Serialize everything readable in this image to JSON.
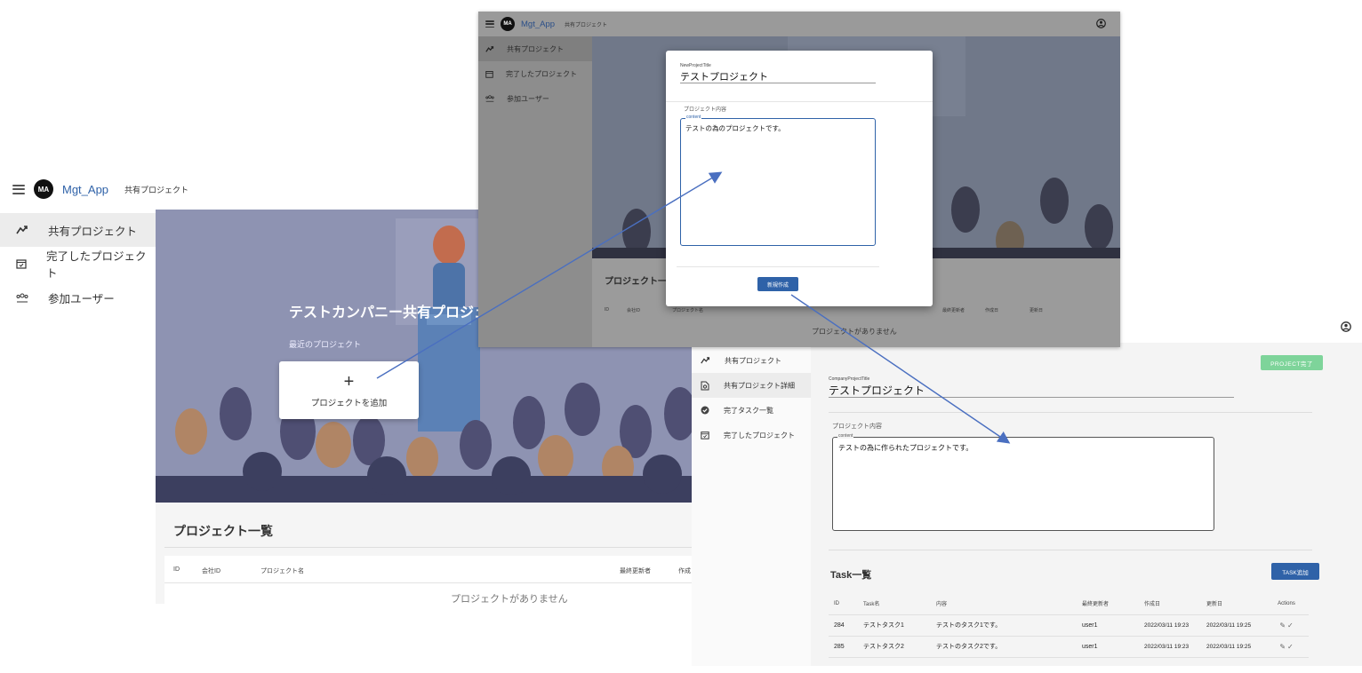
{
  "left": {
    "app_initials": "MA",
    "app_name": "Mgt_App",
    "breadcrumb": "共有プロジェクト",
    "nav": [
      {
        "label": "共有プロジェクト",
        "icon": "share-icon"
      },
      {
        "label": "完了したプロジェクト",
        "icon": "calendar-check-icon"
      },
      {
        "label": "参加ユーザー",
        "icon": "group-icon"
      }
    ],
    "hero_title": "テストカンパニー共有プロジェ",
    "recent_label": "最近のプロジェクト",
    "add_plus": "+",
    "add_label": "プロジェクトを追加",
    "list_title": "プロジェクト一覧",
    "columns": [
      "ID",
      "会社ID",
      "プロジェクト名",
      "最終更新者",
      "作成"
    ],
    "empty_text": "プロジェクトがありません"
  },
  "top": {
    "app_initials": "MA",
    "app_name": "Mgt_App",
    "breadcrumb": "共有プロジェクト",
    "nav": [
      {
        "label": "共有プロジェクト",
        "icon": "share-icon"
      },
      {
        "label": "完了したプロジェクト",
        "icon": "calendar-check-icon"
      },
      {
        "label": "参加ユーザー",
        "icon": "group-icon"
      }
    ],
    "modal": {
      "title_caption": "NewProjectTitle",
      "title_value": "テストプロジェクト",
      "content_section": "プロジェクト内容",
      "content_legend": "content",
      "content_value": "テストの為のプロジェクトです。",
      "create_button": "新規作成"
    },
    "list_title": "プロジェクト一",
    "columns": [
      "ID",
      "会社ID",
      "プロジェクト名",
      "最終更新者",
      "作成日",
      "更新日"
    ],
    "empty_text": "プロジェクトがありません"
  },
  "right": {
    "nav": [
      {
        "label": "共有プロジェクト",
        "icon": "share-icon"
      },
      {
        "label": "共有プロジェクト詳細",
        "icon": "document-search-icon"
      },
      {
        "label": "完了タスク一覧",
        "icon": "check-circle-icon"
      },
      {
        "label": "完了したプロジェクト",
        "icon": "calendar-check-icon"
      }
    ],
    "complete_button": "PROJECT完了",
    "title_caption": "CompanyProjectTitle",
    "title_value": "テストプロジェクト",
    "content_section": "プロジェクト内容",
    "content_legend": "content",
    "content_value": "テストの為に作られたプロジェクトです。",
    "task_title": "Task一覧",
    "add_task_button": "TASK追加",
    "columns": [
      "ID",
      "Task名",
      "内容",
      "最終更新者",
      "作成日",
      "更新日",
      "Actions"
    ],
    "tasks": [
      {
        "id": "284",
        "name": "テストタスク1",
        "content": "テストのタスク1です。",
        "updater": "user1",
        "created": "2022/03/11 19:23",
        "updated": "2022/03/11 19:25"
      },
      {
        "id": "285",
        "name": "テストタスク2",
        "content": "テストのタスク2です。",
        "updater": "user1",
        "created": "2022/03/11 19:23",
        "updated": "2022/03/11 19:25"
      }
    ]
  },
  "colors": {
    "accent_blue": "#2f62a8",
    "complete_green": "#7ed49a",
    "arrow": "#4a6fc0"
  }
}
